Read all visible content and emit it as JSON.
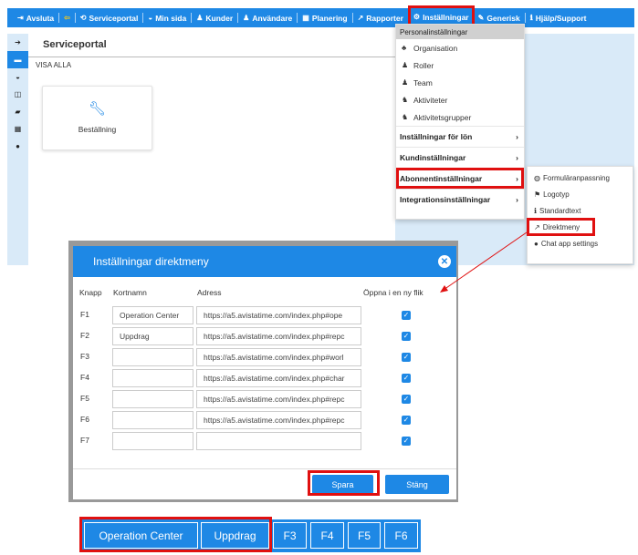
{
  "nav": {
    "items": [
      {
        "icon": "sign-out-icon",
        "glyph": "⇥",
        "label": "Avsluta"
      },
      {
        "icon": "arrow-left-icon",
        "glyph": "⇦",
        "label": ""
      },
      {
        "icon": "refresh-icon",
        "glyph": "⟲",
        "label": "Serviceportal"
      },
      {
        "icon": "dashboard-icon",
        "glyph": "◒",
        "label": "Min sida"
      },
      {
        "icon": "user-icon",
        "glyph": "♟",
        "label": "Kunder"
      },
      {
        "icon": "user-icon",
        "glyph": "♟",
        "label": "Användare"
      },
      {
        "icon": "calendar-icon",
        "glyph": "▦",
        "label": "Planering"
      },
      {
        "icon": "line-chart-icon",
        "glyph": "↗",
        "label": "Rapporter"
      },
      {
        "icon": "cogs-icon",
        "glyph": "⚙",
        "label": "Inställningar"
      },
      {
        "icon": "wrench-icon",
        "glyph": "✎",
        "label": "Generisk"
      },
      {
        "icon": "info-icon",
        "glyph": "ℹ",
        "label": "Hjälp/Support"
      }
    ],
    "highlight_color": "#e01010",
    "accent_color": "#1e88e5"
  },
  "sidebar": {
    "icons": [
      {
        "name": "arrow-right-icon",
        "glyph": "➔"
      },
      {
        "name": "list-icon",
        "glyph": "▬"
      },
      {
        "name": "dashboard-icon",
        "glyph": "◒"
      },
      {
        "name": "columns-icon",
        "glyph": "◫"
      },
      {
        "name": "book-icon",
        "glyph": "▰"
      },
      {
        "name": "grid-icon",
        "glyph": "▦"
      },
      {
        "name": "comments-icon",
        "glyph": "●"
      }
    ]
  },
  "page": {
    "title": "Serviceportal",
    "filter": "VISA ALLA",
    "tile_label": "Beställning",
    "tile_icon": "wrench-icon"
  },
  "dropdown": {
    "header": "Personalinställningar",
    "items": [
      {
        "icon": "sitemap-icon",
        "glyph": "♣",
        "label": "Organisation"
      },
      {
        "icon": "users-icon",
        "glyph": "♟",
        "label": "Roller"
      },
      {
        "icon": "users-icon",
        "glyph": "♟",
        "label": "Team"
      },
      {
        "icon": "activity-icon",
        "glyph": "♞",
        "label": "Aktiviteter"
      },
      {
        "icon": "activity-icon",
        "glyph": "♞",
        "label": "Aktivitetsgrupper"
      }
    ],
    "submenus": [
      {
        "label": "Inställningar för lön"
      },
      {
        "label": "Kundinställningar"
      },
      {
        "label": "Abonnentinställningar"
      },
      {
        "label": "Integrationsinställningar"
      }
    ]
  },
  "submenu": {
    "items": [
      {
        "icon": "globe-icon",
        "glyph": "◍",
        "label": "Formuläranpassning"
      },
      {
        "icon": "flag-icon",
        "glyph": "⚑",
        "label": "Logotyp"
      },
      {
        "icon": "info-icon",
        "glyph": "ℹ",
        "label": "Standardtext"
      },
      {
        "icon": "external-link-icon",
        "glyph": "↗",
        "label": "Direktmeny"
      },
      {
        "icon": "comments-icon",
        "glyph": "●",
        "label": "Chat app settings"
      }
    ]
  },
  "modal": {
    "title": "Inställningar direktmeny",
    "columns": [
      "Knapp",
      "Kortnamn",
      "Adress",
      "Öppna i en ny flik"
    ],
    "rows": [
      {
        "key": "F1",
        "name": "Operation Center",
        "address": "https://a5.avistatime.com/index.php#ope",
        "new_tab": true
      },
      {
        "key": "F2",
        "name": "Uppdrag",
        "address": "https://a5.avistatime.com/index.php#repc",
        "new_tab": true
      },
      {
        "key": "F3",
        "name": "",
        "address": "https://a5.avistatime.com/index.php#worl",
        "new_tab": true
      },
      {
        "key": "F4",
        "name": "",
        "address": "https://a5.avistatime.com/index.php#char",
        "new_tab": true
      },
      {
        "key": "F5",
        "name": "",
        "address": "https://a5.avistatime.com/index.php#repc",
        "new_tab": true
      },
      {
        "key": "F6",
        "name": "",
        "address": "https://a5.avistatime.com/index.php#repc",
        "new_tab": true
      },
      {
        "key": "F7",
        "name": "",
        "address": "",
        "new_tab": true
      }
    ],
    "save_label": "Spara",
    "close_label": "Stäng"
  },
  "quickbar": {
    "buttons": [
      "Operation Center",
      "Uppdrag",
      "F3",
      "F4",
      "F5",
      "F6"
    ]
  }
}
